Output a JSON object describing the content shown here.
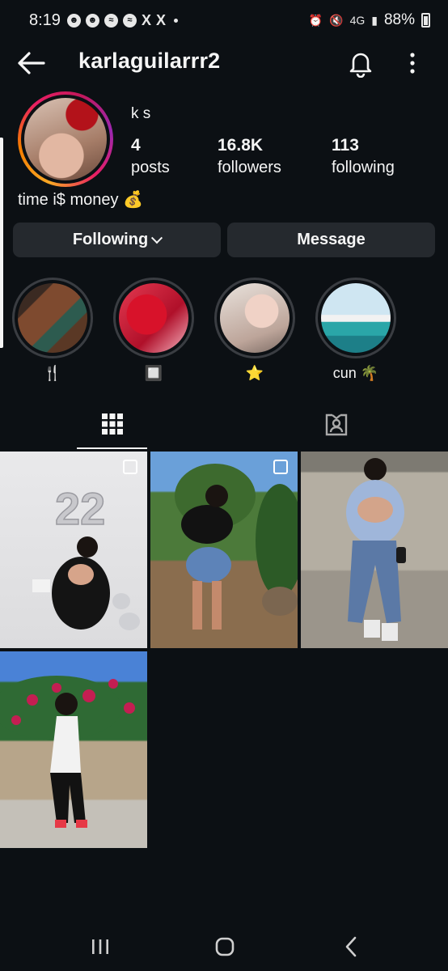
{
  "status_bar": {
    "time": "8:19",
    "battery": "88%",
    "network": "4G"
  },
  "header": {
    "username": "karlaguilarrr2"
  },
  "profile": {
    "display_name": "k s",
    "posts_count": "4",
    "posts_label": "posts",
    "followers_count": "16.8K",
    "followers_label": "followers",
    "following_count": "113",
    "following_label": "following",
    "bio": "time i$ money 💰"
  },
  "actions": {
    "following_label": "Following",
    "message_label": "Message"
  },
  "highlights": [
    {
      "label": "🍴"
    },
    {
      "label": "🔲"
    },
    {
      "label": "⭐"
    },
    {
      "label": "cun 🌴"
    }
  ],
  "post_overlay_text": "22",
  "colors": {
    "background": "#0c1014",
    "button": "#25292e",
    "text": "#f5f5f5"
  }
}
